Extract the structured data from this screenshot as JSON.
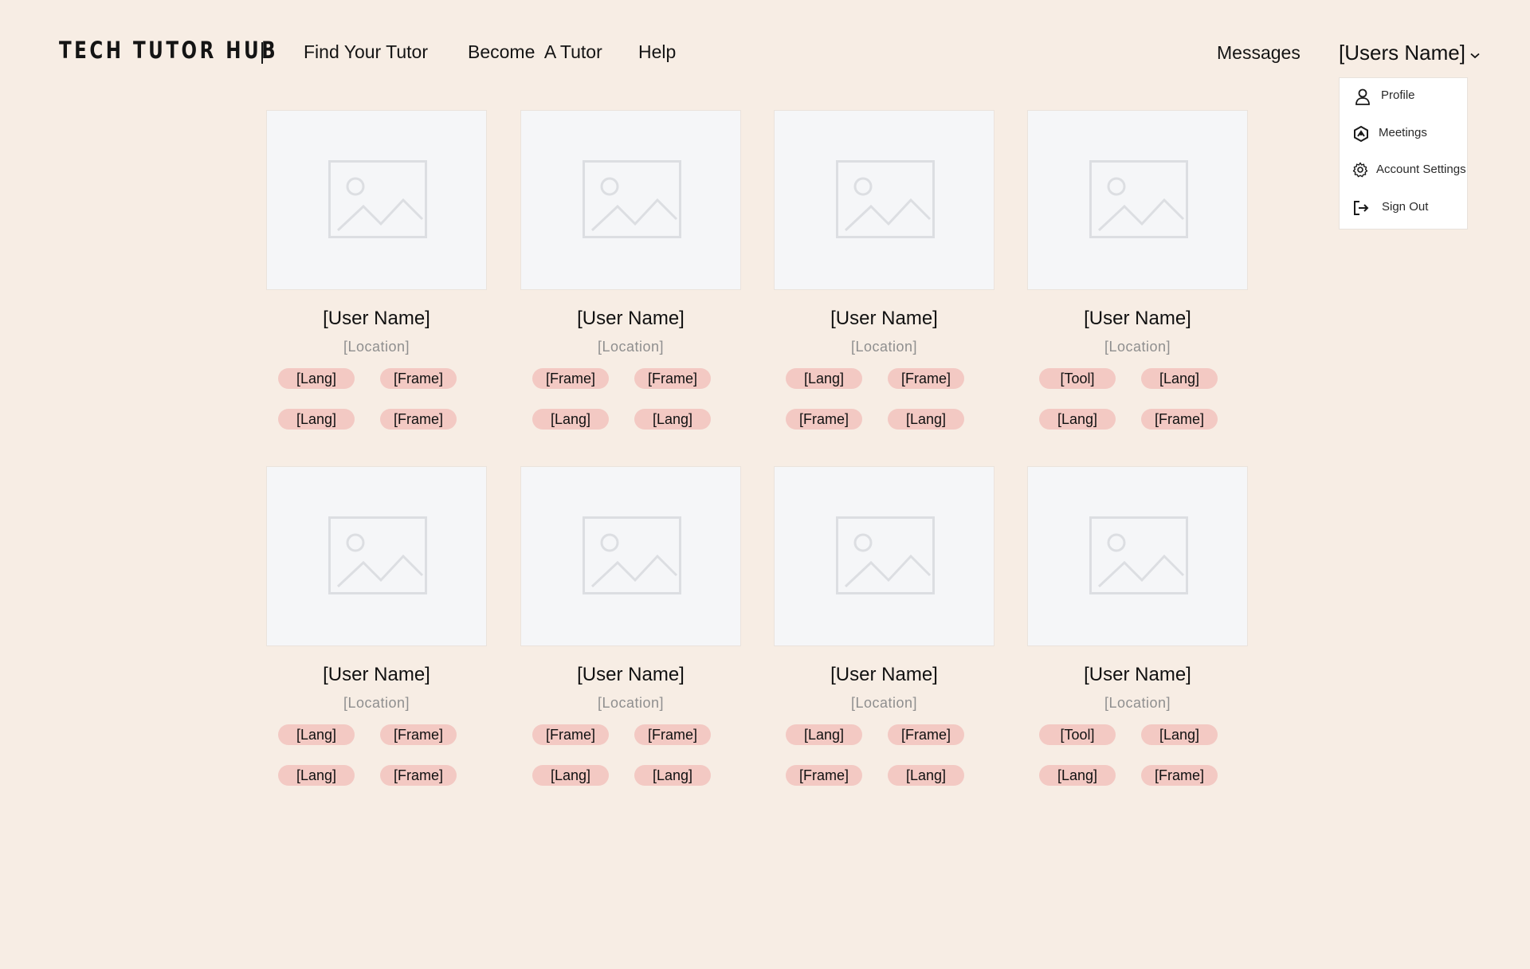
{
  "header": {
    "logo": "TECH TUTOR HUB",
    "nav": [
      {
        "label": "Find Your Tutor"
      },
      {
        "label": "Become  A Tutor"
      },
      {
        "label": "Help"
      }
    ],
    "messages": "Messages",
    "user_name": "[Users Name]"
  },
  "user_dropdown": {
    "items": [
      {
        "label": "Profile",
        "icon": "user-icon"
      },
      {
        "label": "Meetings",
        "icon": "meetings-icon"
      },
      {
        "label": "Account Settings",
        "icon": "gear-icon"
      },
      {
        "label": "Sign Out",
        "icon": "sign-out-icon"
      }
    ]
  },
  "tutors": [
    {
      "name": "[User Name]",
      "location": "[Location]",
      "tags": [
        "[Lang]",
        "[Frame]",
        "[Lang]",
        "[Frame]"
      ]
    },
    {
      "name": "[User Name]",
      "location": "[Location]",
      "tags": [
        "[Frame]",
        "[Frame]",
        "[Lang]",
        "[Lang]"
      ]
    },
    {
      "name": "[User Name]",
      "location": "[Location]",
      "tags": [
        "[Lang]",
        "[Frame]",
        "[Frame]",
        "[Lang]"
      ]
    },
    {
      "name": "[User Name]",
      "location": "[Location]",
      "tags": [
        "[Tool]",
        "[Lang]",
        "[Lang]",
        "[Frame]"
      ]
    },
    {
      "name": "[User Name]",
      "location": "[Location]",
      "tags": [
        "[Lang]",
        "[Frame]",
        "[Lang]",
        "[Frame]"
      ]
    },
    {
      "name": "[User Name]",
      "location": "[Location]",
      "tags": [
        "[Frame]",
        "[Frame]",
        "[Lang]",
        "[Lang]"
      ]
    },
    {
      "name": "[User Name]",
      "location": "[Location]",
      "tags": [
        "[Lang]",
        "[Frame]",
        "[Frame]",
        "[Lang]"
      ]
    },
    {
      "name": "[User Name]",
      "location": "[Location]",
      "tags": [
        "[Tool]",
        "[Lang]",
        "[Lang]",
        "[Frame]"
      ]
    }
  ],
  "colors": {
    "background": "#f7ede4",
    "tag": "#f3c9c3",
    "card_image": "#f5f6f8",
    "placeholder_stroke": "#dcdee2"
  }
}
